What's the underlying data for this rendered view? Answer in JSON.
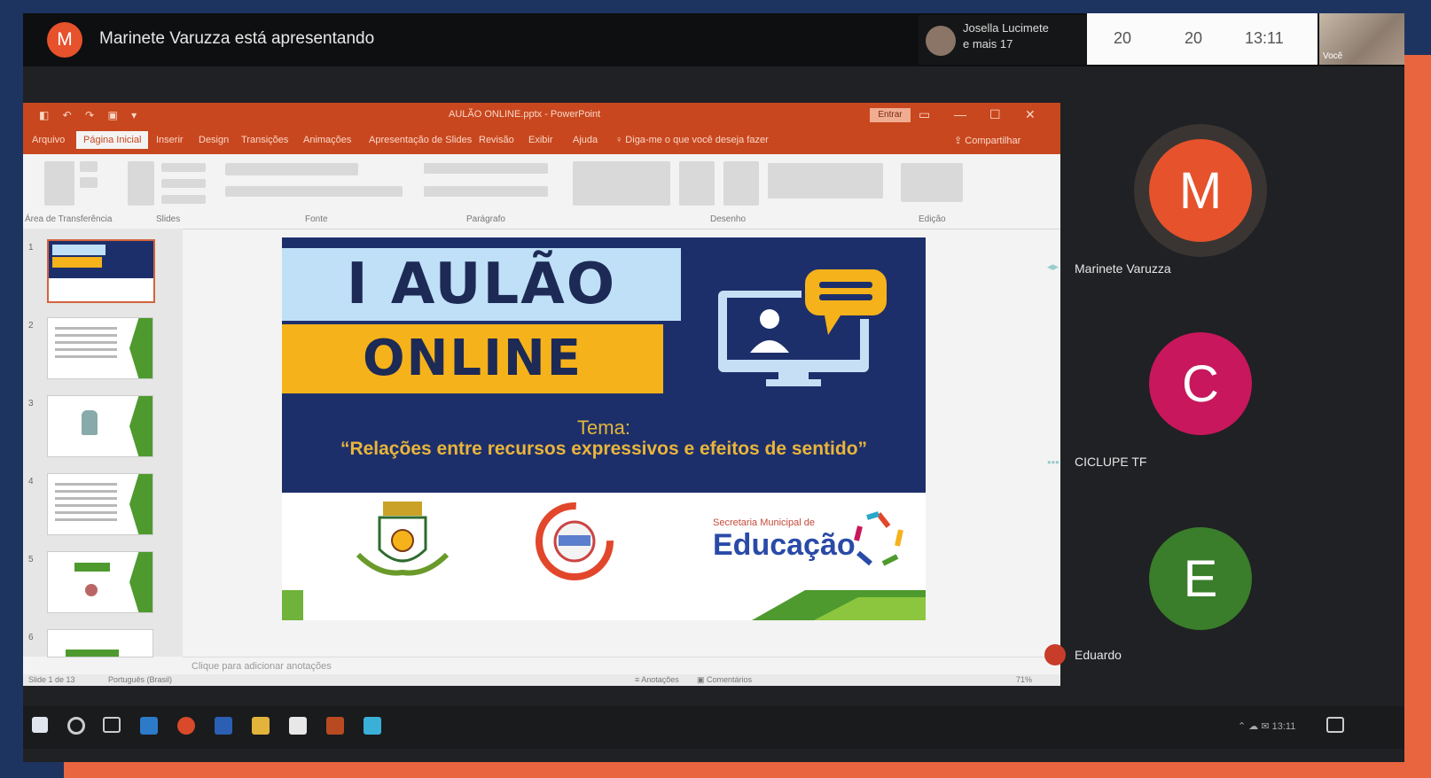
{
  "meet": {
    "presenter_avatar": "M",
    "presenting_text": "Marinete Varuzza está apresentando",
    "participants_text_line1": "Josella Lucimete",
    "participants_text_line2": "e mais 17",
    "stats": [
      "20",
      "20",
      "13:11"
    ],
    "self_label": "Você"
  },
  "ppt": {
    "qat": "◧ ↶ ↷ ▣ ▾",
    "doc_title": "AULÃO ONLINE.pptx - PowerPoint",
    "signin": "Entrar",
    "window_controls": [
      "▭",
      "—",
      "☐",
      "✕"
    ],
    "tabs": [
      "Arquivo",
      "Página Inicial",
      "Inserir",
      "Design",
      "Transições",
      "Animações",
      "Apresentação de Slides",
      "Revisão",
      "Exibir",
      "Ajuda",
      "♀ Diga-me o que você deseja fazer",
      "⇪ Compartilhar"
    ],
    "ribbon_groups": [
      "Área de Transferência",
      "Slides",
      "Fonte",
      "Parágrafo",
      "Desenho",
      "Edição"
    ],
    "thumb_numbers": [
      "1",
      "2",
      "3",
      "4",
      "5",
      "6"
    ],
    "notes": "Clique para adicionar anotações",
    "status_left": "Slide 1 de 13",
    "status_lang": "Português (Brasil)",
    "status_notes": "≡ Anotações",
    "status_comments": "▣ Comentários",
    "status_zoom": "71%"
  },
  "slide": {
    "line1": "I AULÃO",
    "line2": "ONLINE",
    "tema": "Tema:",
    "subtitle": "“Relações entre recursos  expressivos e efeitos de sentido”",
    "edu_small": "Secretaria Municipal de",
    "edu_big": "Educação"
  },
  "tiles": [
    {
      "letter": "M",
      "name": "Marinete Varuzza",
      "color": "#e6522c"
    },
    {
      "letter": "C",
      "name": "CICLUPE TF",
      "color": "#c8175d"
    },
    {
      "letter": "E",
      "name": "Eduardo",
      "color": "#3a7d2a"
    }
  ],
  "taskbar": {
    "tray": "⌃ ☁ ✉ 13:11"
  }
}
